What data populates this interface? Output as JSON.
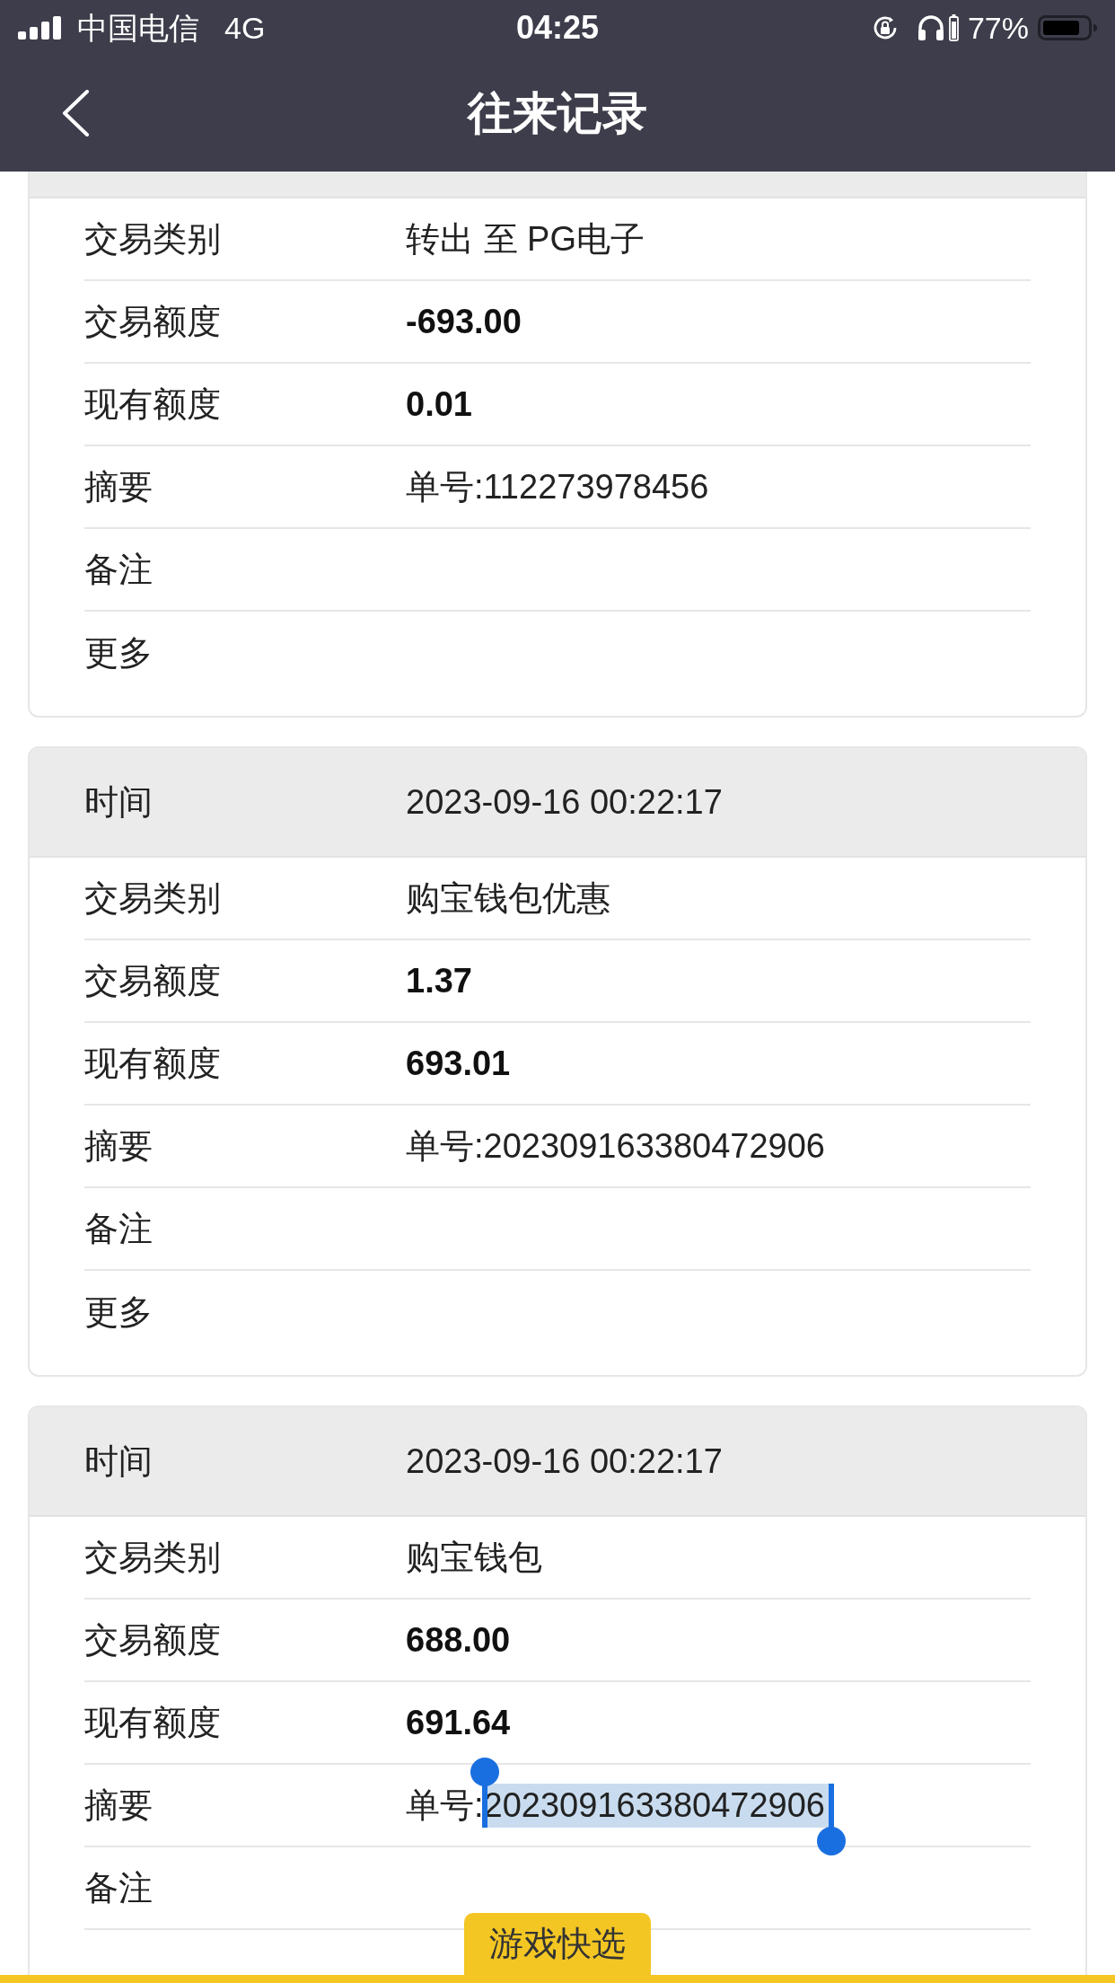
{
  "status_bar": {
    "carrier": "中国电信",
    "network": "4G",
    "time": "04:25",
    "battery": "77%"
  },
  "nav_bar": {
    "title": "往来记录"
  },
  "records": [
    {
      "rows": [
        {
          "label": "交易类别",
          "kind": "text",
          "value": "转出 至 PG电子"
        },
        {
          "label": "交易额度",
          "kind": "amount",
          "value": "-693.00"
        },
        {
          "label": "现有额度",
          "kind": "amount",
          "value": "0.01"
        },
        {
          "label": "摘要",
          "kind": "text",
          "value": "单号:112273978456"
        },
        {
          "label": "备注",
          "kind": "text"
        },
        {
          "label": "更多",
          "kind": "text"
        }
      ]
    },
    {
      "time_label": "时间",
      "time": "2023-09-16 00:22:17",
      "rows": [
        {
          "label": "交易类别",
          "kind": "text",
          "value": "购宝钱包优惠"
        },
        {
          "label": "交易额度",
          "kind": "amount",
          "value": "1.37"
        },
        {
          "label": "现有额度",
          "kind": "amount",
          "value": "693.01"
        },
        {
          "label": "摘要",
          "kind": "text",
          "value": "单号:202309163380472906"
        },
        {
          "label": "备注",
          "kind": "text"
        },
        {
          "label": "更多",
          "kind": "text"
        }
      ]
    },
    {
      "time_label": "时间",
      "time": "2023-09-16 00:22:17",
      "rows": [
        {
          "label": "交易类别",
          "kind": "text",
          "value": "购宝钱包"
        },
        {
          "label": "交易额度",
          "kind": "amount",
          "value": "688.00"
        },
        {
          "label": "现有额度",
          "kind": "amount",
          "value": "691.64"
        },
        {
          "label": "摘要",
          "kind": "selection",
          "parts": [
            {
              "text": "单号:",
              "selected": false
            },
            {
              "text": "202309163380472906",
              "selected": true
            }
          ]
        },
        {
          "label": "备注",
          "kind": "text"
        },
        {
          "kind": "text"
        }
      ]
    }
  ],
  "quick_tab": {
    "label": "游戏快选"
  }
}
